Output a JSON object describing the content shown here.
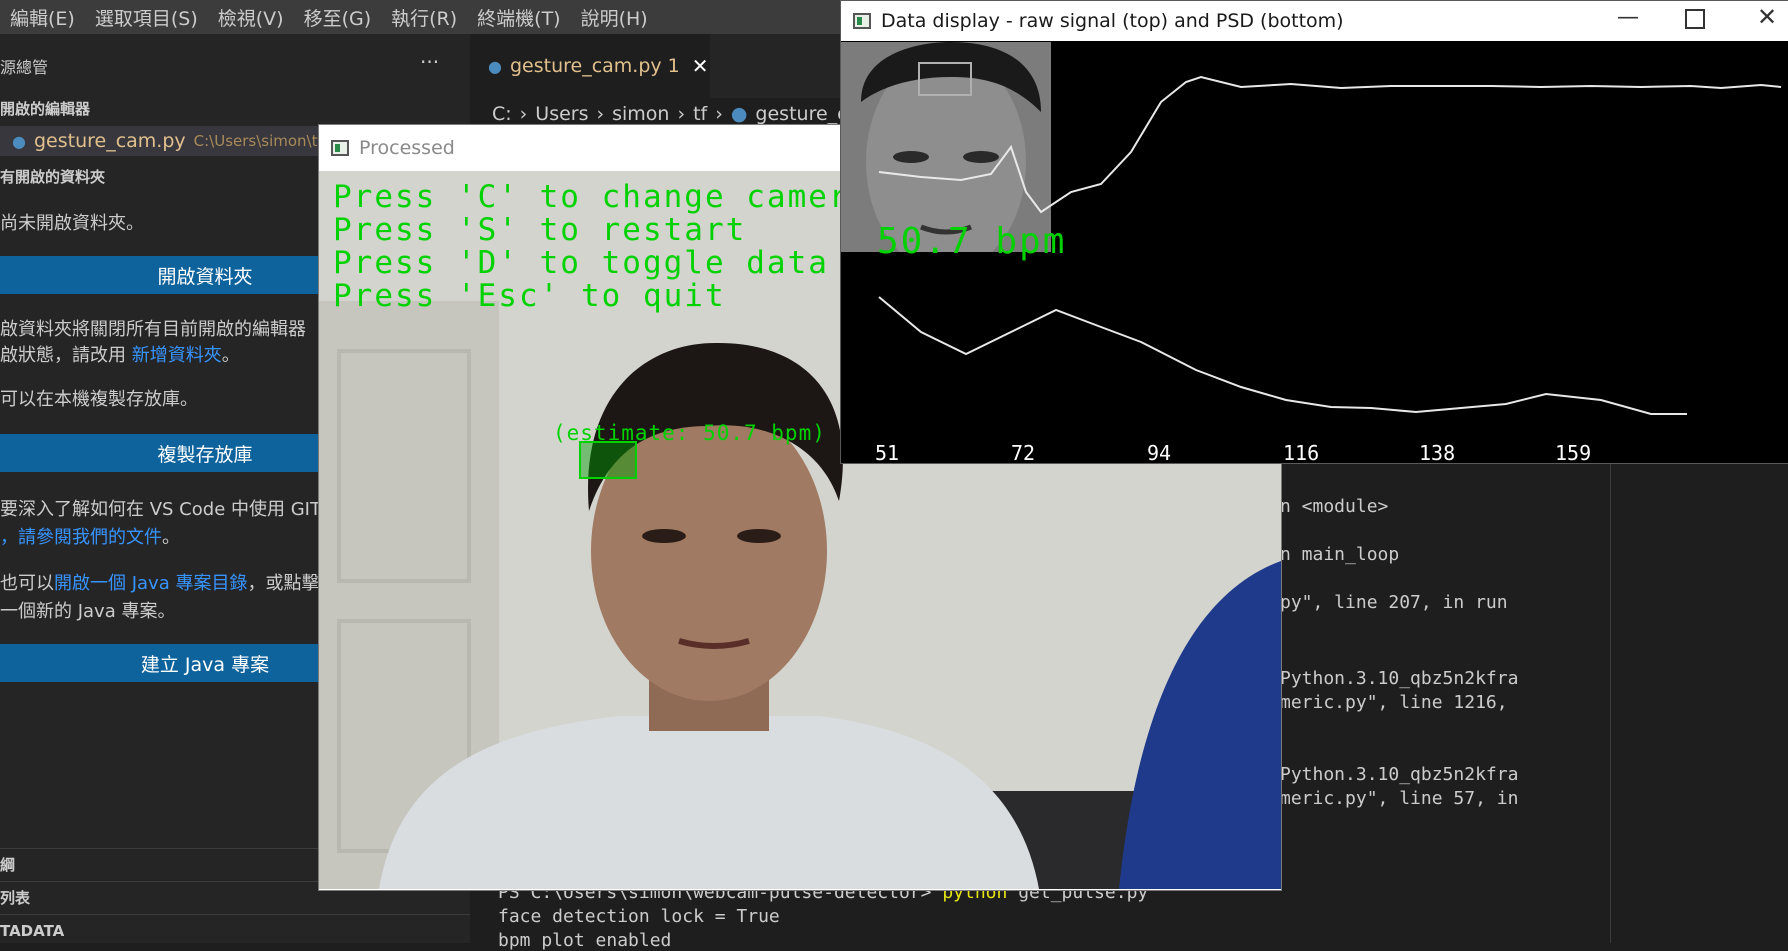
{
  "menubar": {
    "items": [
      "編輯(E)",
      "選取項目(S)",
      "檢視(V)",
      "移至(G)",
      "執行(R)",
      "終端機(T)",
      "說明(H)"
    ]
  },
  "sidebar": {
    "title": "源總管",
    "more_label": "···",
    "open_editors_title": "開啟的編輯器",
    "open_file_name": "gesture_cam.py",
    "open_file_path": "C:\\Users\\simon\\tf",
    "no_folder_title": "有開啟的資料夾",
    "no_folder_msg": "尚未開啟資料夾。",
    "open_folder_button": "開啟資料夾",
    "para1_line1": "啟資料夾將關閉所有目前開啟的編輯器",
    "para1_line2_prefix": "啟狀態，請改用 ",
    "para1_link": "新增資料夾",
    "para1_line2_suffix": "。",
    "para2": "可以在本機複製存放庫。",
    "clone_button": "複製存放庫",
    "para3_line1": "要深入了解如何在 VS Code 中使用 GIT",
    "para3_line2_link": "，請參閱我們的文件",
    "para3_line2_suffix": "。",
    "para4_prefix": "也可以",
    "para4_link": "開啟一個 Java 專案目錄",
    "para4_suffix": "，或點擊",
    "para4_line2": "一個新的 Java 專案。",
    "java_button": "建立 Java 專案",
    "bottom_sections": [
      "綱",
      "列表",
      "TADATA"
    ]
  },
  "editor": {
    "tab_label": "gesture_cam.py",
    "tab_problems": "1",
    "tab_close": "✕",
    "breadcrumb": [
      "C:",
      "Users",
      "simon",
      "tf",
      "gesture_ca"
    ]
  },
  "terminal": {
    "lines": [
      "n <module>",
      "n main_loop",
      "py\", line 207, in run",
      "Python.3.10_qbz5n2kfra",
      "meric.py\", line 1216,",
      "Python.3.10_qbz5n2kfra",
      "meric.py\", line 57, in"
    ],
    "prompt": "PS C:\\Users\\simon\\webcam-pulse-detector>",
    "command": "python",
    "command_arg": " get_pulse.py",
    "out1": "face detection lock = True",
    "out2": "bpm plot enabled"
  },
  "processed_window": {
    "title": "Processed",
    "instructions": [
      "Press 'C' to change camera (cu",
      "Press 'S' to restart",
      "Press 'D' to toggle data pl",
      "Press 'Esc' to quit"
    ],
    "estimate_label": "(estimate: 50.7 bpm)"
  },
  "data_window": {
    "title": "Data display - raw signal (top) and PSD (bottom)",
    "bpm_text": "50.7 bpm",
    "psd_ticks": [
      "51",
      "72",
      "94",
      "116",
      "138",
      "159"
    ]
  },
  "colors": {
    "vscode_bg": "#1e1e1e",
    "sidebar_bg": "#252526",
    "accent_blue": "#0e639c",
    "link": "#3794ff",
    "cv_green": "#00d200",
    "modified_yellow": "#e2c08d"
  }
}
